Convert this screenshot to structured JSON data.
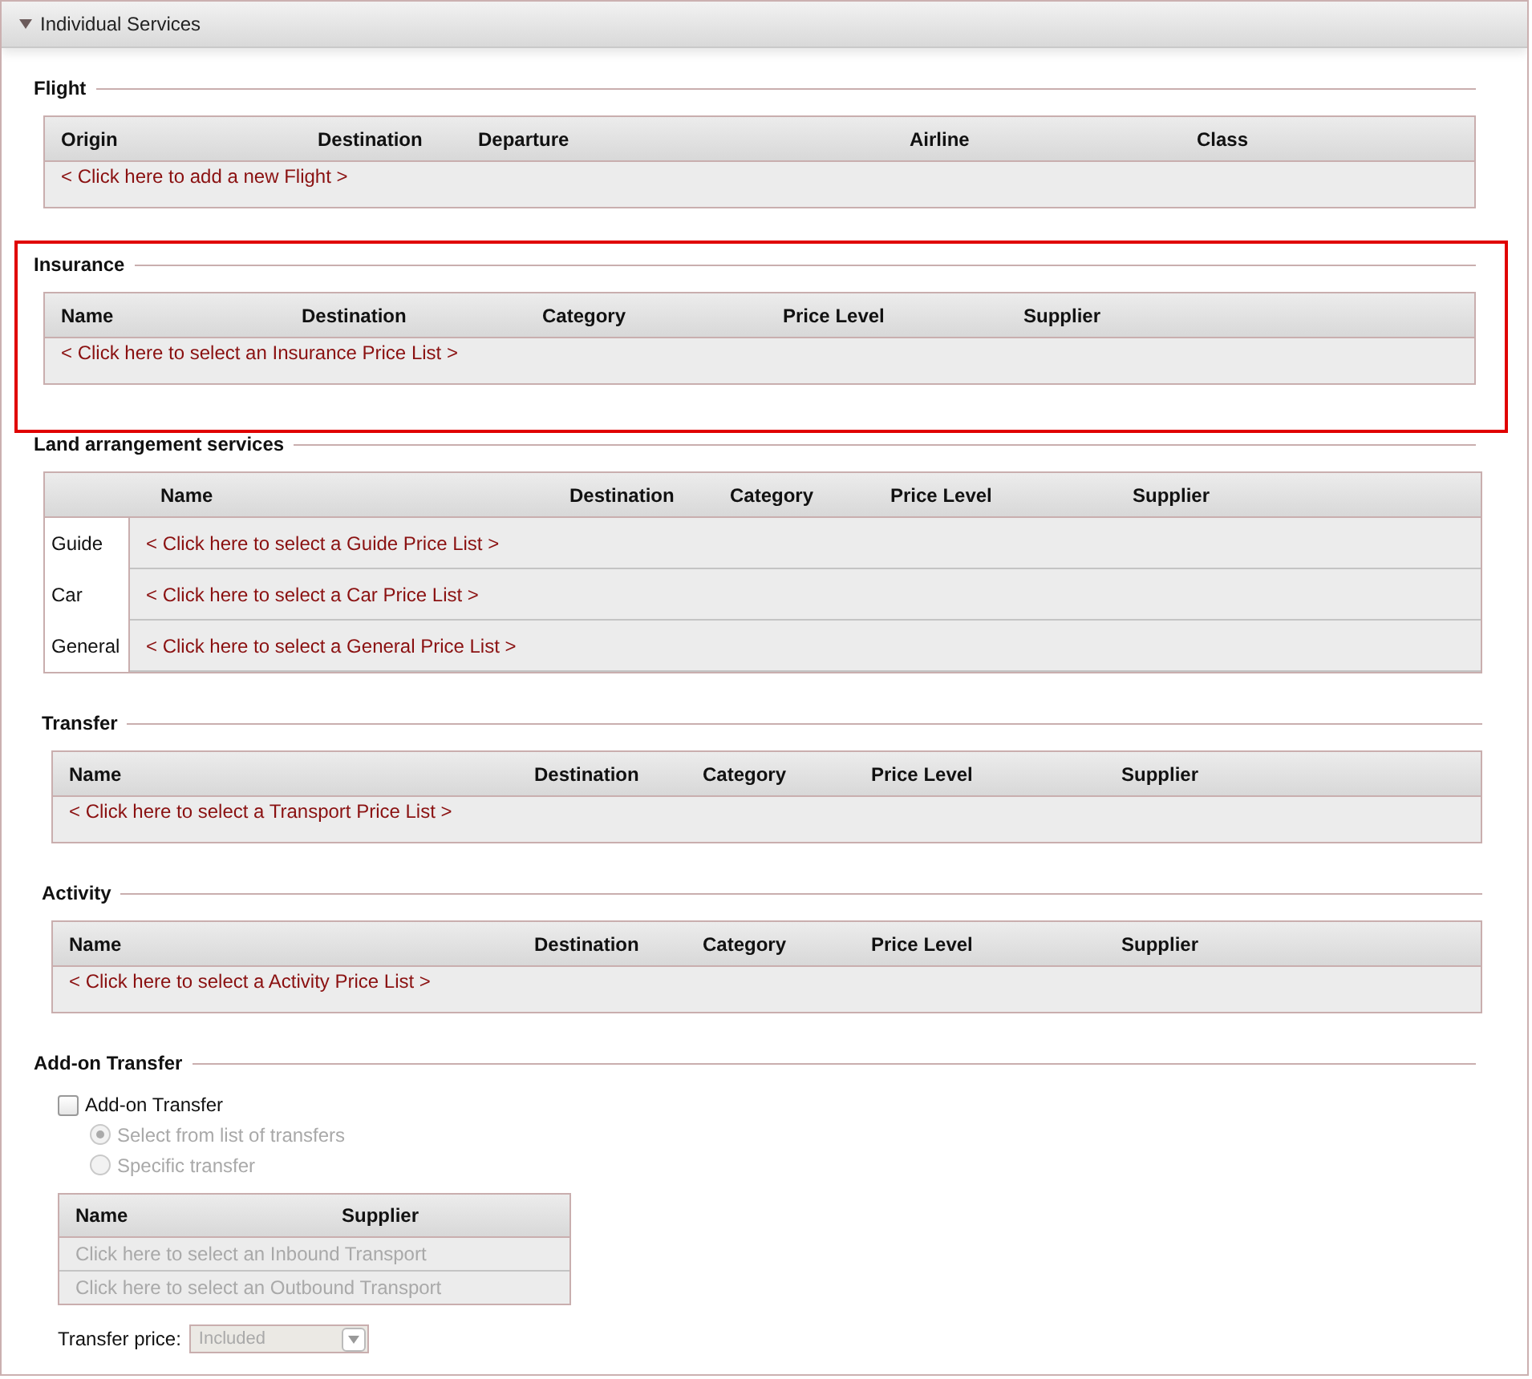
{
  "panel": {
    "title": "Individual Services",
    "expanded": true
  },
  "sections": [
    {
      "kind": "table",
      "title": "Flight",
      "highlighted": false,
      "columns": [
        "Origin",
        "Destination",
        "Departure",
        "Airline",
        "Class"
      ],
      "rows": [
        {
          "link": "< Click here to add a new Flight >"
        }
      ]
    },
    {
      "kind": "table",
      "title": "Insurance",
      "highlighted": true,
      "columns": [
        "Name",
        "Destination",
        "Category",
        "Price Level",
        "Supplier"
      ],
      "rows": [
        {
          "link": "< Click here to select an Insurance Price List >"
        }
      ]
    },
    {
      "kind": "grouped",
      "title": "Land arrangement services",
      "highlighted": false,
      "columns": [
        "Name",
        "Destination",
        "Category",
        "Price Level",
        "Supplier"
      ],
      "rows": [
        {
          "label": "Guide",
          "link": "< Click here to select a Guide Price List >"
        },
        {
          "label": "Car",
          "link": "< Click here to select a Car Price List >"
        },
        {
          "label": "General",
          "link": "< Click here to select a General Price List >"
        }
      ]
    },
    {
      "kind": "table",
      "title": "Transfer",
      "highlighted": false,
      "columns": [
        "Name",
        "Destination",
        "Category",
        "Price Level",
        "Supplier"
      ],
      "rows": [
        {
          "link": "< Click here to select a Transport Price List >"
        }
      ]
    },
    {
      "kind": "table",
      "title": "Activity",
      "highlighted": false,
      "columns": [
        "Name",
        "Destination",
        "Category",
        "Price Level",
        "Supplier"
      ],
      "rows": [
        {
          "link": "< Click here to select a Activity Price List >"
        }
      ]
    },
    {
      "kind": "addon",
      "title": "Add-on Transfer",
      "highlighted": false,
      "checkbox": {
        "label": "Add-on Transfer",
        "checked": false
      },
      "options": [
        {
          "label": "Select from list of transfers",
          "selected": true,
          "disabled": true
        },
        {
          "label": "Specific transfer",
          "selected": false,
          "disabled": true
        }
      ],
      "columns": [
        "Name",
        "Supplier"
      ],
      "rows": [
        {
          "link": "Click here to select an Inbound Transport",
          "disabled": true
        },
        {
          "link": "Click here to select an Outbound Transport",
          "disabled": true
        }
      ],
      "price": {
        "label": "Transfer price:",
        "value": "Included",
        "disabled": true
      }
    }
  ]
}
